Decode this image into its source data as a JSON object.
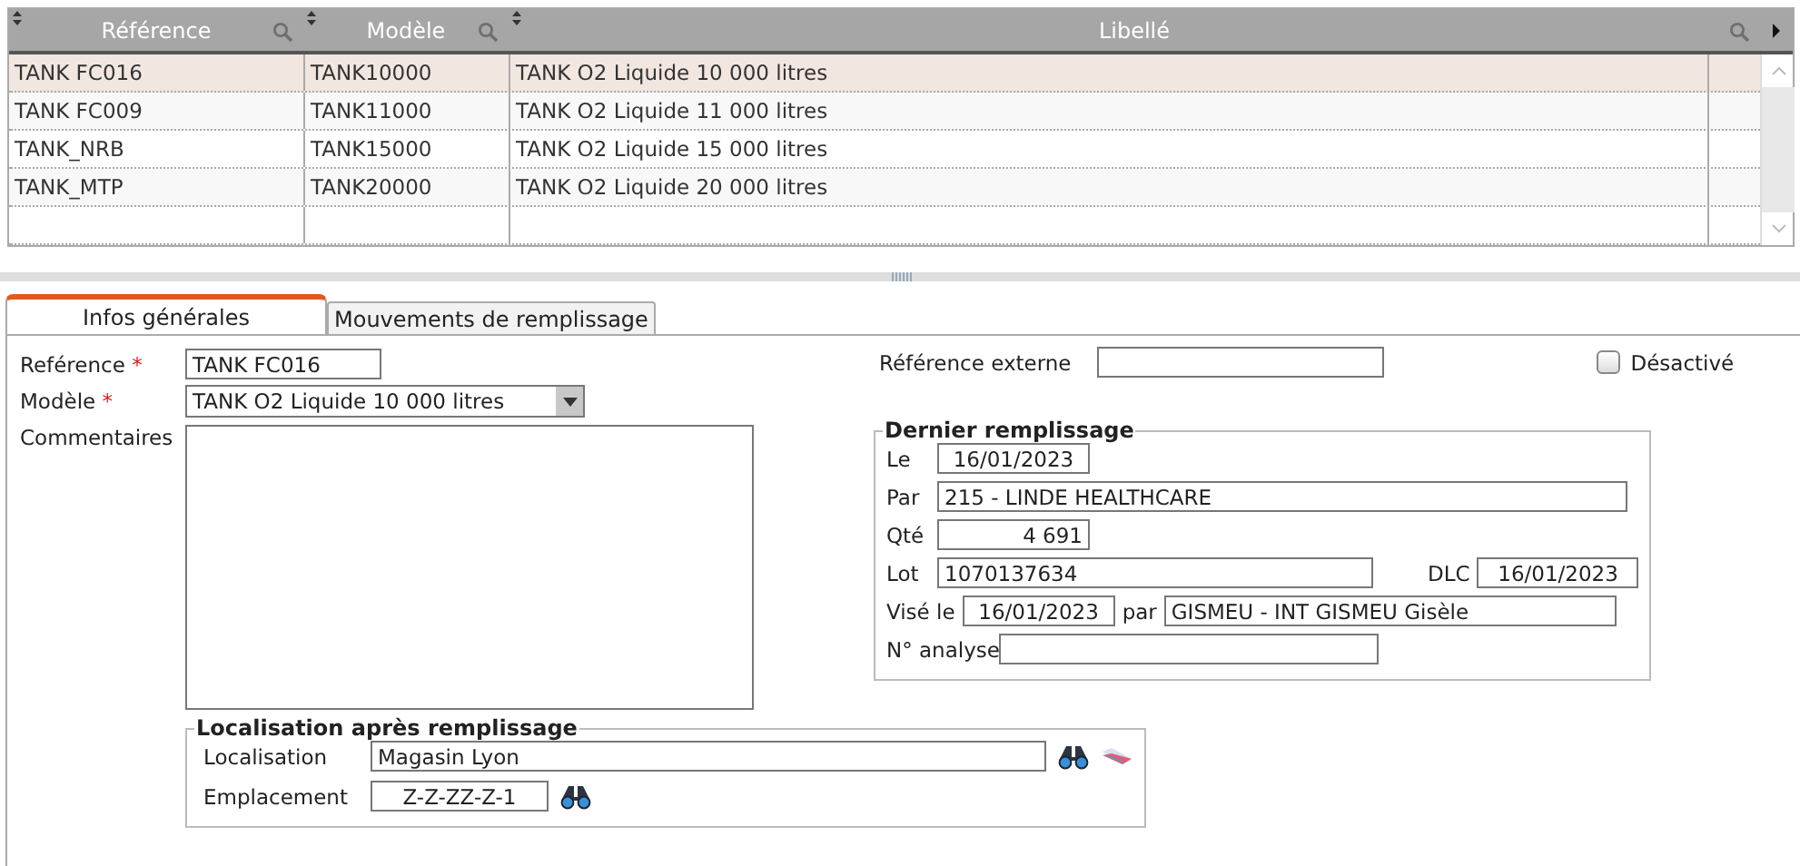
{
  "table": {
    "columns": [
      {
        "label": "Référence",
        "searchable": true
      },
      {
        "label": "Modèle",
        "searchable": true
      },
      {
        "label": "Libellé",
        "searchable": true
      }
    ],
    "rows": [
      {
        "cells": [
          "TANK FC016",
          "TANK10000",
          "TANK O2 Liquide 10 000 litres"
        ],
        "selected": true
      },
      {
        "cells": [
          "TANK FC009",
          "TANK11000",
          "TANK O2 Liquide 11 000 litres"
        ],
        "selected": false
      },
      {
        "cells": [
          "TANK_NRB",
          "TANK15000",
          "TANK O2 Liquide 15 000 litres"
        ],
        "selected": false
      },
      {
        "cells": [
          "TANK_MTP",
          "TANK20000",
          "TANK O2 Liquide 20 000 litres"
        ],
        "selected": false
      }
    ]
  },
  "tabs": [
    {
      "label": "Infos générales",
      "selected": true
    },
    {
      "label": "Mouvements de remplissage",
      "selected": false
    }
  ],
  "form": {
    "reference": {
      "label": "Reférence",
      "required_mark": "*",
      "value": "TANK FC016"
    },
    "modele": {
      "label": "Modèle",
      "required_mark": "*",
      "value": "TANK O2 Liquide 10 000 litres"
    },
    "commentaires": {
      "label": "Commentaires"
    },
    "reference_externe": {
      "label": "Référence externe"
    },
    "desactive": {
      "label": "Désactivé",
      "checked": false
    }
  },
  "dernier_remplissage": {
    "title": "Dernier remplissage",
    "le": {
      "label": "Le",
      "value": "16/01/2023"
    },
    "par": {
      "label": "Par",
      "value": "215 - LINDE HEALTHCARE"
    },
    "qte": {
      "label": "Qté",
      "value": "4 691"
    },
    "lot": {
      "label": "Lot",
      "value": "1070137634"
    },
    "dlc": {
      "label": "DLC",
      "value": "16/01/2023"
    },
    "vise_le": {
      "label": "Visé le",
      "value": "16/01/2023"
    },
    "vise_par": {
      "label": "par",
      "value": "GISMEU - INT GISMEU Gisèle"
    },
    "n_analyse": {
      "label": "N° analyse"
    }
  },
  "localisation": {
    "title": "Localisation après remplissage",
    "localisation": {
      "label": "Localisation",
      "value": "Magasin Lyon"
    },
    "emplacement": {
      "label": "Emplacement",
      "value": "Z-Z-ZZ-Z-1"
    }
  }
}
